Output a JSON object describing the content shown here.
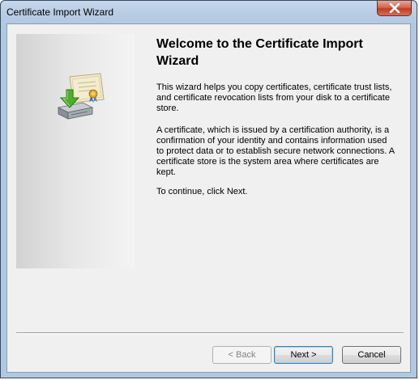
{
  "window": {
    "title": "Certificate Import Wizard",
    "close_icon": "close-icon"
  },
  "content": {
    "heading": "Welcome to the Certificate Import Wizard",
    "paragraph1": "This wizard helps you copy certificates, certificate trust lists, and certificate revocation lists from your disk to a certificate store.",
    "paragraph2": "A certificate, which is issued by a certification authority, is a confirmation of your identity and contains information used to protect data or to establish secure network connections. A certificate store is the system area where certificates are kept.",
    "paragraph3": "To continue, click Next.",
    "icon": "certificate-import-icon"
  },
  "buttons": {
    "back": "< Back",
    "next": "Next >",
    "cancel": "Cancel"
  },
  "colors": {
    "titlebar": "#b9cde4",
    "close_button": "#c23b22",
    "dialog_background": "#f0f0f0",
    "default_button_border": "#3c7fb1"
  }
}
